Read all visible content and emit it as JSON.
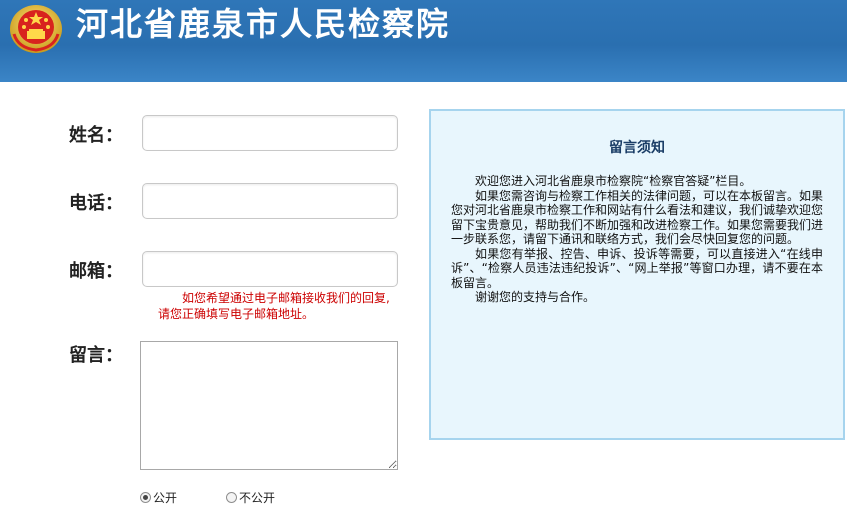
{
  "header": {
    "title": "河北省鹿泉市人民检察院",
    "emblem_icon": "national-emblem-icon"
  },
  "form": {
    "name_label": "姓名：",
    "name_value": "",
    "phone_label": "电话：",
    "phone_value": "",
    "email_label": "邮箱：",
    "email_value": "",
    "email_hint_line1": "如您希望通过电子邮箱接收我们的回复,",
    "email_hint_line2": "请您正确填写电子邮箱地址。",
    "message_label": "留言：",
    "message_value": "",
    "visibility_options": [
      {
        "label": "公开",
        "selected": true
      },
      {
        "label": "不公开",
        "selected": false
      }
    ]
  },
  "notice": {
    "title": "留言须知",
    "paragraphs": [
      "欢迎您进入河北省鹿泉市检察院“检察官答疑”栏目。",
      "如果您需咨询与检察工作相关的法律问题，可以在本板留言。如果您对河北省鹿泉市检察工作和网站有什么看法和建议，我们诚挚欢迎您留下宝贵意见，帮助我们不断加强和改进检察工作。如果您需要我们进一步联系您，请留下通讯和联络方式，我们会尽快回复您的问题。",
      "如果您有举报、控告、申诉、投诉等需要，可以直接进入“在线申诉”、“检察人员违法违纪投诉”、“网上举报”等窗口办理，请不要在本板留言。",
      "谢谢您的支持与合作。"
    ]
  },
  "colors": {
    "header_blue": "#2f76b8",
    "hint_red": "#cc0000",
    "notice_bg": "#e8f6fd",
    "notice_border": "#a6d4ee"
  }
}
